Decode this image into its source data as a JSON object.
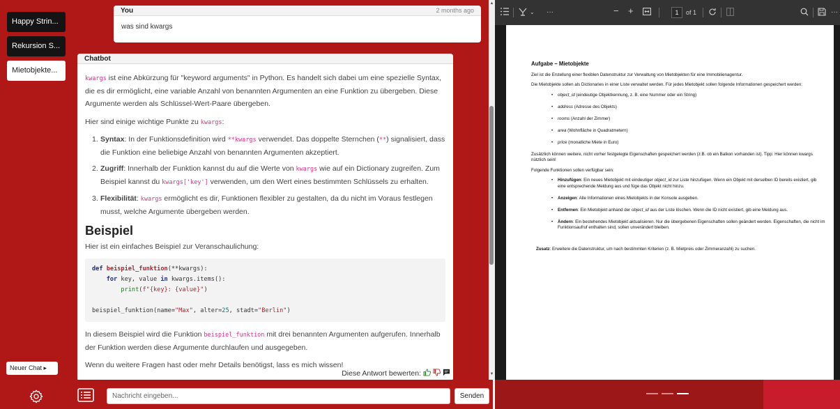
{
  "sidebar": {
    "chats": [
      {
        "label": "Happy Strin..."
      },
      {
        "label": "Rekursion S..."
      },
      {
        "label": "Mietobjekte..."
      }
    ],
    "new_chat_label": "Neuer Chat ▸"
  },
  "user_message": {
    "author": "You",
    "time": "2 months ago",
    "text": "was sind kwargs"
  },
  "bot_message": {
    "author": "Chatbot",
    "intro_code": "kwargs",
    "intro_text": " ist eine Abkürzung für \"keyword arguments\" in Python. Es handelt sich dabei um eine spezielle Syntax, die es dir ermöglicht, eine variable Anzahl von benannten Argumenten an eine Funktion zu übergeben. Diese Argumente werden als Schlüssel-Wert-Paare übergeben.",
    "points_intro": "Hier sind einige wichtige Punkte zu ",
    "points_code": "kwargs",
    "points_colon": ":",
    "points": [
      {
        "num": "1.",
        "title": "Syntax",
        "t1": ": In der Funktionsdefinition wird ",
        "c1": "**kwargs",
        "t2": " verwendet. Das doppelte Sternchen (",
        "c2": "**",
        "t3": ") signalisiert, dass die Funktion eine beliebige Anzahl von benannten Argumenten akzeptiert."
      },
      {
        "num": "2.",
        "title": "Zugriff",
        "t1": ": Innerhalb der Funktion kannst du auf die Werte von ",
        "c1": "kwargs",
        "t2": " wie auf ein Dictionary zugreifen. Zum Beispiel kannst du ",
        "c2": "kwargs['key']",
        "t3": " verwenden, um den Wert eines bestimmten Schlüssels zu erhalten."
      },
      {
        "num": "3.",
        "title": "Flexibilität",
        "t1": ": ",
        "c1": "kwargs",
        "t2": " ermöglicht es dir, Funktionen flexibler zu gestalten, da du nicht im Voraus festlegen musst, welche Argumente übergeben werden.",
        "c2": "",
        "t3": ""
      }
    ],
    "example_heading": "Beispiel",
    "example_intro": "Hier ist ein einfaches Beispiel zur Veranschaulichung:",
    "code": {
      "l1_kw": "def",
      "l1_fn": "beispiel_funktion",
      "l1_rest": "(**kwargs):",
      "l2_kw1": "for",
      "l2_mid": " key, value ",
      "l2_kw2": "in",
      "l2_rest": " kwargs.items():",
      "l3_bi": "print",
      "l3_rest": "(",
      "l3_str": "f\"{key}: {value}\"",
      "l3_end": ")",
      "l4_a": "beispiel_funktion(name=",
      "l4_s1": "\"Max\"",
      "l4_b": ", alter=",
      "l4_n": "25",
      "l4_c": ", stadt=",
      "l4_s2": "\"Berlin\"",
      "l4_d": ")"
    },
    "outro_t1": "In diesem Beispiel wird die Funktion ",
    "outro_code": "beispiel_funktion",
    "outro_t2": " mit drei benannten Argumenten aufgerufen. Innerhalb der Funktion werden diese Argumente durchlaufen und ausgegeben.",
    "closing": "Wenn du weitere Fragen hast oder mehr Details benötigst, lass es mich wissen!",
    "rate_label": "Diese Antwort bewerten:"
  },
  "input": {
    "placeholder": "Nachricht eingeben...",
    "send_label": "Senden"
  },
  "pdf_toolbar": {
    "more": "···",
    "minus": "−",
    "plus": "+",
    "page": "1",
    "of_pages": "of 1"
  },
  "pdf": {
    "title": "Aufgabe – Mietobjekte",
    "p1": "Ziel ist die Erstellung einer flexiblen Datenstruktur zur Verwaltung von Mietobjekten für eine Immobilienagentur.",
    "p2": "Die Mietobjekte sollen als Dictionaries in einer Liste verwaltet werden. Für jedes Mietobjekt sollen folgende Informationen gespeichert werden:",
    "fields": [
      {
        "name": "object_id",
        "desc": " (eindeutige Objektkennung, z. B. eine Nummer oder ein String)"
      },
      {
        "name": "address",
        "desc": " (Adresse des Objekts)"
      },
      {
        "name": "rooms",
        "desc": " (Anzahl der Zimmer)"
      },
      {
        "name": "area",
        "desc": " (Wohnfläche in Quadratmetern)"
      },
      {
        "name": "price",
        "desc": " (monatliche Miete in Euro)"
      }
    ],
    "p3": "Zusätzlich können weitere, nicht vorher festgelegte Eigenschaften gespeichert werden (z.B. ob ein Balkon vorhanden ist). Tipp: Hier können kwargs nützlich sein!",
    "p4": "Folgende Funktionen sollen verfügbar sein:",
    "functions": [
      {
        "name": "Hinzufügen",
        "t1": ": Ein neues Mietobjekt mit eindeutiger ",
        "em": "object_id",
        "t2": " zur Liste hinzufügen. Wenn ein Objekt mit derselben ID bereits existiert, gib eine entsprechende Meldung aus und füge das Objekt nicht hinzu."
      },
      {
        "name": "Anzeigen",
        "t1": ": Alle Informationen eines Mietobjekts in der Konsole ausgeben.",
        "em": "",
        "t2": ""
      },
      {
        "name": "Entfernen",
        "t1": ": Ein Mietobjekt anhand der ",
        "em": "object_id",
        "t2": " aus der Liste löschen. Wenn die ID nicht existiert, gib eine Meldung aus."
      },
      {
        "name": "Ändern",
        "t1": ": Ein bestehendes Mietobjekt aktualisieren. Nur die übergebenen Eigenschaften sollen geändert werden. Eigenschaften, die nicht im Funktionsaufruf enthalten sind, sollen unverändert bleiben.",
        "em": "",
        "t2": ""
      }
    ],
    "zusatz_label": "Zusatz",
    "zusatz_text": ": Erweitere die Datenstruktur, um nach bestimmten Kriterien (z. B. Mietpreis oder Zimmeranzahl) zu suchen."
  },
  "colors": {
    "brand_red": "#b01717",
    "pdf_bg": "#1a1a1a",
    "code_pink": "#d63384"
  }
}
